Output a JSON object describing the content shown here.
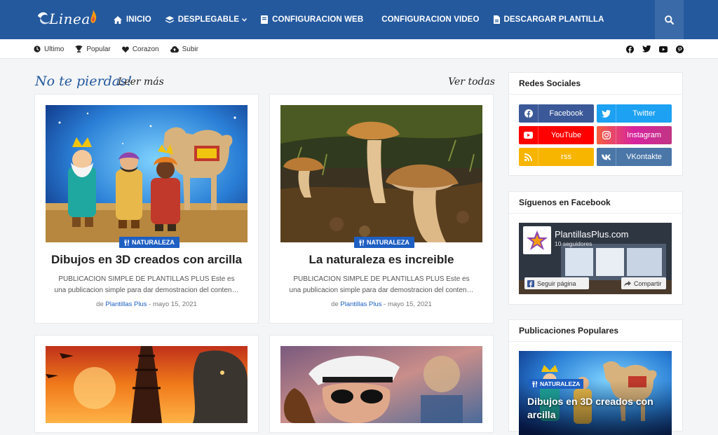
{
  "header": {
    "logo_text": "Linea",
    "menu": [
      {
        "label": "INICIO",
        "icon": "home-icon"
      },
      {
        "label": "DESPLEGABLE",
        "icon": "layers-icon"
      },
      {
        "label": "CONFIGURACION WEB",
        "icon": "book-icon"
      },
      {
        "label": "CONFIGURACION VIDEO",
        "icon": ""
      },
      {
        "label": "DESCARGAR PLANTILLA",
        "icon": "file-icon"
      }
    ],
    "search_icon": "search-icon"
  },
  "subnav": {
    "links": [
      {
        "label": "Ultimo",
        "icon": "clock-icon"
      },
      {
        "label": "Popular",
        "icon": "trophy-icon"
      },
      {
        "label": "Corazon",
        "icon": "heart-icon"
      },
      {
        "label": "Subir",
        "icon": "cloud-upload-icon"
      }
    ],
    "social": [
      "facebook-icon",
      "twitter-icon",
      "youtube-icon",
      "pinterest-icon"
    ]
  },
  "section": {
    "title": "No te pierdas!",
    "subtitle": "Leer más",
    "view_all": "Ver todas"
  },
  "posts": [
    {
      "category": "NATURALEZA",
      "title": "Dibujos en 3D creados con arcilla",
      "snippet": "PUBLICACION SIMPLE DE PLANTILLAS PLUS Este es una publicacion simple para dar demostracion del conten…",
      "by": "de",
      "author": "Plantillas Plus",
      "date": "- mayo 15, 2021"
    },
    {
      "category": "NATURALEZA",
      "title": "La naturaleza es increible",
      "snippet": "PUBLICACION SIMPLE DE PLANTILLAS PLUS Este es una publicacion simple para dar demostracion del conten…",
      "by": "de",
      "author": "Plantillas Plus",
      "date": "- mayo 15, 2021"
    }
  ],
  "sidebar": {
    "social_title": "Redes Sociales",
    "social_buttons": [
      {
        "label": "Facebook",
        "color": "#3b5998"
      },
      {
        "label": "Twitter",
        "color": "#1da1f2"
      },
      {
        "label": "YouTube",
        "color": "#ff0000"
      },
      {
        "label": "Instagram",
        "color": "#d6249f"
      },
      {
        "label": "rss",
        "color": "#f7b500"
      },
      {
        "label": "VKontakte",
        "color": "#4a76a8"
      }
    ],
    "facebook_title": "Síguenos en Facebook",
    "facebook_page": {
      "name": "PlantillasPlus.com",
      "followers": "10 seguidores",
      "follow_label": "Seguir página",
      "share_label": "Compartir"
    },
    "popular_title": "Publicaciones Populares",
    "popular_post": {
      "category": "NATURALEZA",
      "title": "Dibujos en 3D creados con arcilla"
    }
  },
  "colors": {
    "brand": "#24599e",
    "accent": "#1e5fc2"
  }
}
